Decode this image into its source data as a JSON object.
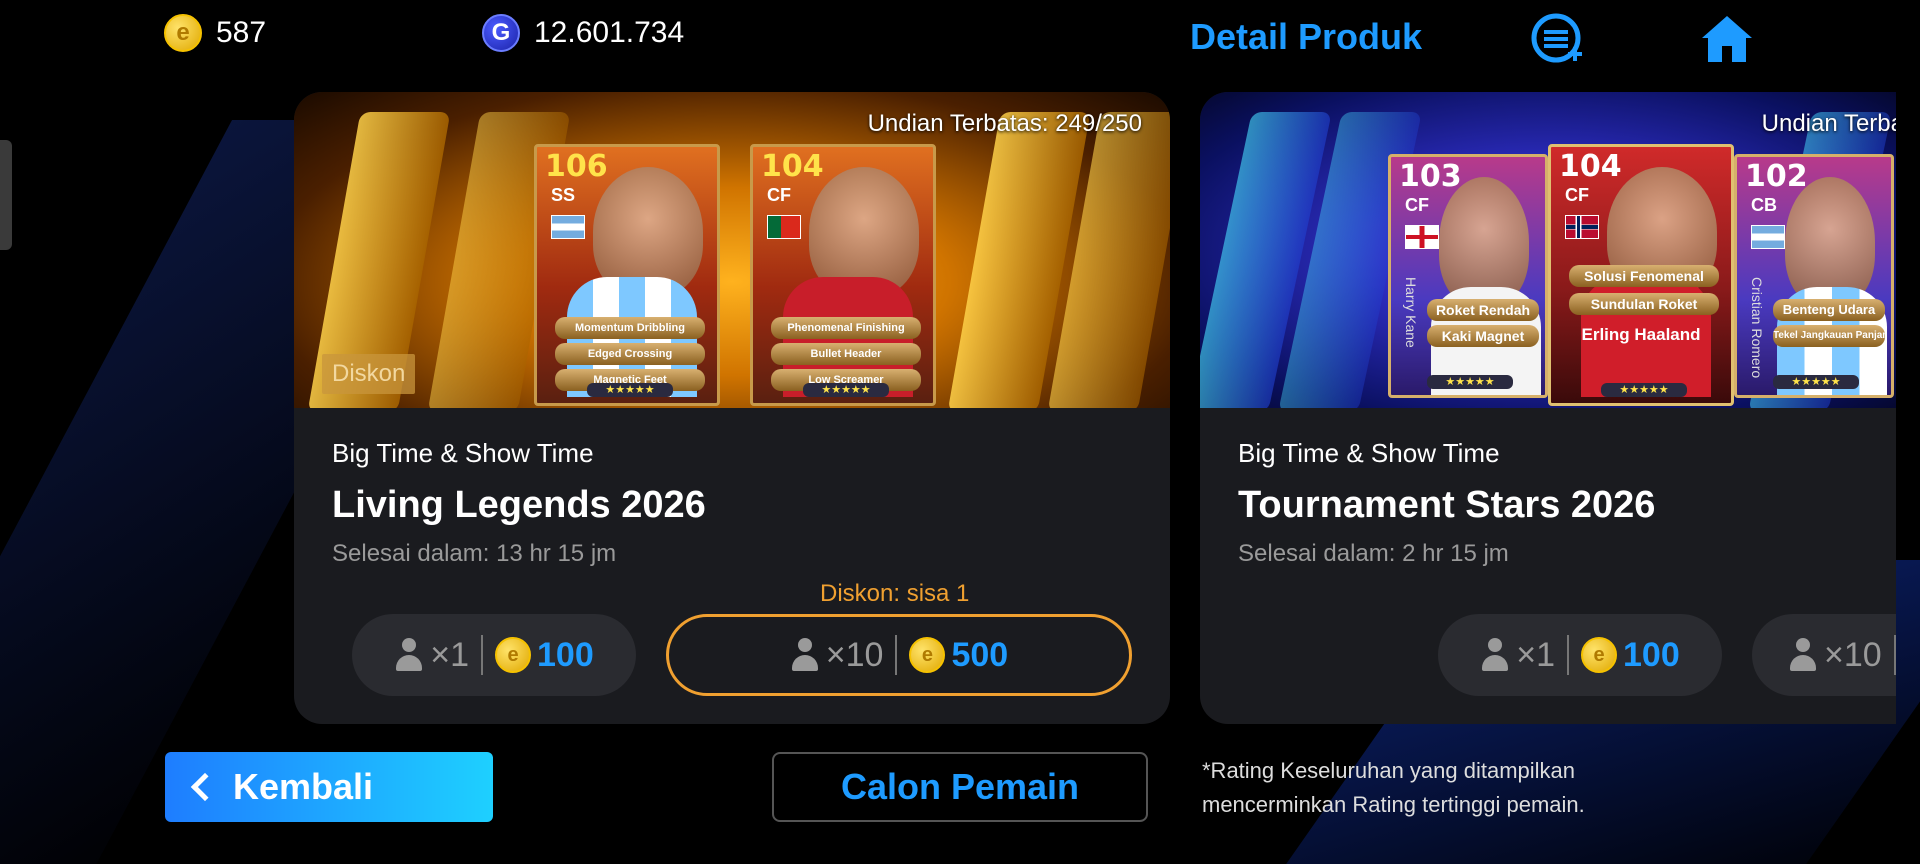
{
  "topbar": {
    "coins": "587",
    "gp": "12.601.734",
    "detail_link": "Detail Produk",
    "coin_symbol": "e",
    "gp_symbol": "G"
  },
  "cards": [
    {
      "limit": "Undian Terbatas: 249/250",
      "discount_tag": "Diskon",
      "subtitle": "Big Time & Show Time",
      "title": "Living Legends 2026",
      "ends": "Selesai dalam: 13 hr 15 jm",
      "discount_left": "Diskon: sisa 1",
      "players": [
        {
          "rating": "106",
          "pos": "SS",
          "skills": [
            "Momentum Dribbling",
            "Edged Crossing",
            "Magnetic Feet"
          ]
        },
        {
          "rating": "104",
          "pos": "CF",
          "skills": [
            "Phenomenal Finishing",
            "Bullet Header",
            "Low Screamer"
          ]
        }
      ],
      "buttons": [
        {
          "mult": "×1",
          "price": "100"
        },
        {
          "mult": "×10",
          "price": "500"
        }
      ]
    },
    {
      "limit": "Undian Terbatas",
      "subtitle": "Big Time & Show Time",
      "title": "Tournament Stars 2026",
      "ends": "Selesai dalam: 2 hr 15 jm",
      "players": [
        {
          "rating": "103",
          "pos": "CF",
          "vname": "Harry Kane",
          "skills": [
            "Roket Rendah",
            "Kaki Magnet"
          ]
        },
        {
          "rating": "104",
          "pos": "CF",
          "name": "Erling Haaland",
          "skills": [
            "Solusi Fenomenal",
            "Sundulan Roket"
          ]
        },
        {
          "rating": "102",
          "pos": "CB",
          "vname": "Cristian Romero",
          "skills": [
            "Benteng Udara",
            "Tekel Jangkauan Panjang"
          ]
        }
      ],
      "buttons": [
        {
          "mult": "×1",
          "price": "100"
        },
        {
          "mult": "×10"
        }
      ]
    }
  ],
  "footer": {
    "back": "Kembali",
    "candidate": "Calon Pemain",
    "footnote": "*Rating Keseluruhan yang ditampilkan\nmencerminkan Rating tertinggi pemain."
  },
  "colors": {
    "accent_blue": "#1e9bff",
    "discount_orange": "#f0a030",
    "coin_gold": "#f6c200"
  },
  "icons": [
    "coin-icon",
    "gp-icon",
    "coin-plus-icon",
    "home-icon",
    "person-icon",
    "chevron-left-icon"
  ]
}
